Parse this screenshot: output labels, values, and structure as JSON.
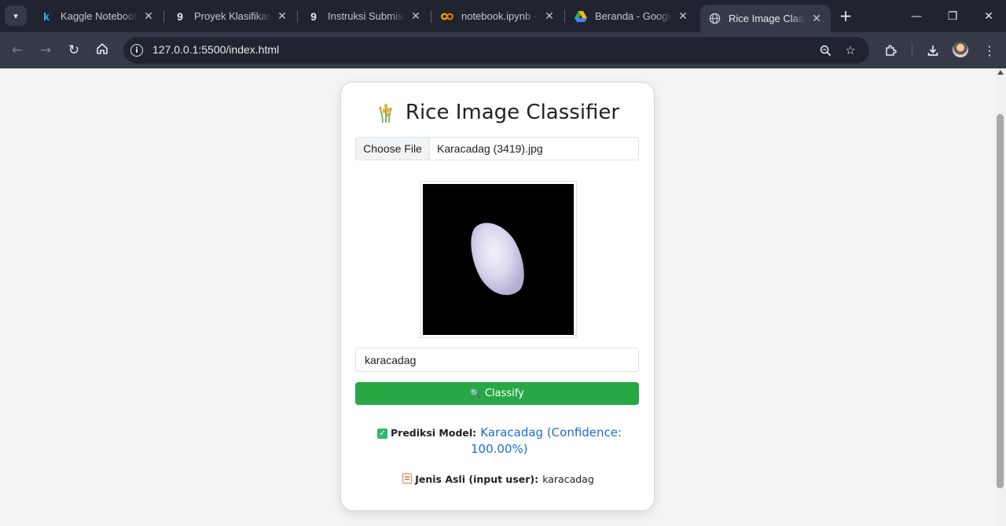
{
  "browser": {
    "tabs": [
      {
        "title": "Kaggle Notebook (",
        "favicon": "kaggle-icon",
        "active": false
      },
      {
        "title": "Proyek Klasifikasi G",
        "favicon": "dicoding-icon",
        "active": false
      },
      {
        "title": "Instruksi Submissio",
        "favicon": "dicoding-icon",
        "active": false
      },
      {
        "title": "notebook.ipynb - C",
        "favicon": "colab-icon",
        "active": false
      },
      {
        "title": "Beranda - Google",
        "favicon": "google-drive-icon",
        "active": false
      },
      {
        "title": "Rice Image Classifie",
        "favicon": "globe-icon",
        "active": true
      }
    ],
    "url": "127.0.0.1:5500/index.html"
  },
  "page": {
    "title": "Rice Image Classifier",
    "file_input": {
      "button_label": "Choose File",
      "file_name": "Karacadag (3419).jpg"
    },
    "label_input": {
      "value": "karacadag"
    },
    "classify_button": {
      "label": "Classify"
    },
    "result": {
      "prediction_label": "Prediksi Model:",
      "prediction_value_line1": "Karacadag (Confidence:",
      "prediction_value_line2": "100.00%)",
      "actual_label": "Jenis Asli (input user):",
      "actual_value": "karacadag"
    }
  },
  "colors": {
    "accent_green": "#28a745",
    "prediction_blue": "#1a6fd0",
    "browser_dark": "#1f2430"
  }
}
